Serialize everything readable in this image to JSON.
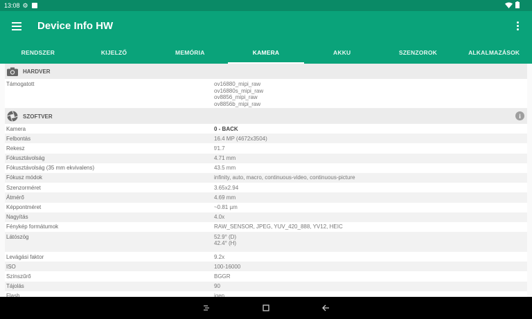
{
  "status": {
    "time": "13:08"
  },
  "app": {
    "title": "Device Info HW"
  },
  "tabs": [
    "RENDSZER",
    "KIJELZŐ",
    "MEMÓRIA",
    "KAMERA",
    "AKKU",
    "SZENZOROK",
    "ALKALMAZÁSOK"
  ],
  "active_tab": "KAMERA",
  "hardware": {
    "title": "HARDVER",
    "supported_label": "Támogatott",
    "supported_values": [
      "ov16880_mipi_raw",
      "ov16880s_mipi_raw",
      "ov8856_mipi_raw",
      "ov8856b_mipi_raw"
    ]
  },
  "software": {
    "title": "SZOFTVER",
    "rows": [
      {
        "label": "Kamera",
        "value": "0 - BACK"
      },
      {
        "label": "Felbontás",
        "value": "16.4 MP (4672x3504)"
      },
      {
        "label": "Rekesz",
        "value": "f/1.7"
      },
      {
        "label": "Fókusztávolság",
        "value": "4.71 mm"
      },
      {
        "label": "Fókusztávolság (35 mm ekvivalens)",
        "value": "43.5 mm"
      },
      {
        "label": "Fókusz módok",
        "value": "infinity, auto, macro, continuous-video, continuous-picture"
      },
      {
        "label": "Szenzorméret",
        "value": "3.65x2.94"
      },
      {
        "label": "Átmérő",
        "value": "4.69 mm"
      },
      {
        "label": "Képpontméret",
        "value": "~0.81 µm"
      },
      {
        "label": "Nagyítás",
        "value": "4.0x"
      },
      {
        "label": "Fénykép formátumok",
        "value": "RAW_SENSOR, JPEG, YUV_420_888, YV12, HEIC"
      },
      {
        "label": "Látószög",
        "value": "52.9° (D)",
        "value2": "42.4° (H)"
      },
      {
        "label": "Levágási faktor",
        "value": "9.2x"
      },
      {
        "label": "ISO",
        "value": "100-16000"
      },
      {
        "label": "Színszűrő",
        "value": "BGGR"
      },
      {
        "label": "Tájolás",
        "value": "90"
      },
      {
        "label": "Flash",
        "value": "igen"
      }
    ]
  }
}
